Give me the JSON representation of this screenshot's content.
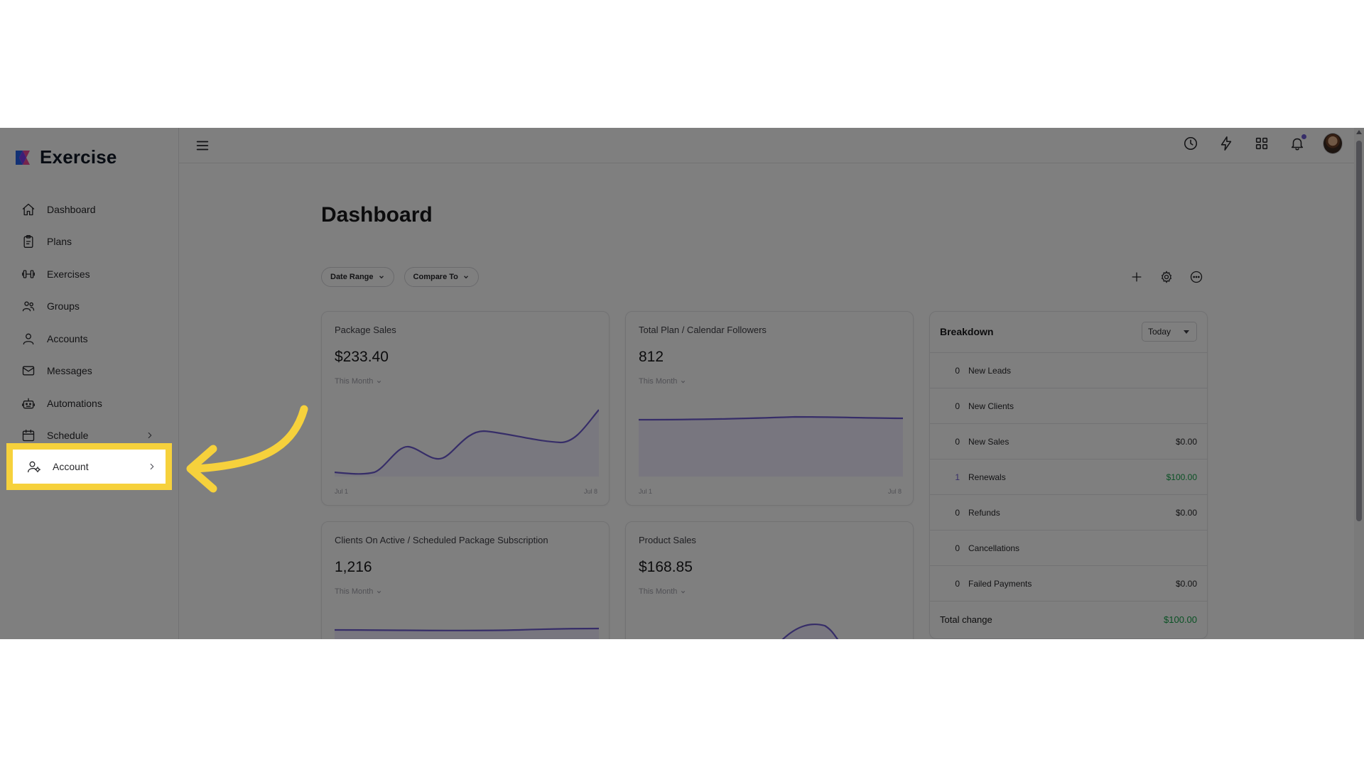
{
  "app": {
    "name": "Exercise"
  },
  "sidebar": {
    "items": [
      {
        "label": "Dashboard",
        "icon": "home-icon"
      },
      {
        "label": "Plans",
        "icon": "clipboard-icon"
      },
      {
        "label": "Exercises",
        "icon": "dumbbell-icon"
      },
      {
        "label": "Groups",
        "icon": "users-icon"
      },
      {
        "label": "Accounts",
        "icon": "user-icon"
      },
      {
        "label": "Messages",
        "icon": "mail-icon"
      },
      {
        "label": "Automations",
        "icon": "robot-icon"
      },
      {
        "label": "Schedule",
        "icon": "calendar-icon"
      },
      {
        "label": "Account",
        "icon": "user-gear-icon"
      }
    ]
  },
  "main": {
    "title": "Dashboard",
    "filters": {
      "date_range": "Date Range",
      "compare_to": "Compare To"
    }
  },
  "cards": {
    "package_sales": {
      "title": "Package Sales",
      "value": "$233.40",
      "period": "This Month",
      "axis_start": "Jul 1",
      "axis_end": "Jul 8"
    },
    "followers": {
      "title": "Total Plan / Calendar Followers",
      "value": "812",
      "period": "This Month",
      "axis_start": "Jul 1",
      "axis_end": "Jul 8"
    },
    "subscriptions": {
      "title": "Clients On Active / Scheduled Package Subscription",
      "value": "1,216",
      "period": "This Month"
    },
    "product_sales": {
      "title": "Product Sales",
      "value": "$168.85",
      "period": "This Month"
    }
  },
  "breakdown": {
    "title": "Breakdown",
    "range": "Today",
    "rows": [
      {
        "count": "0",
        "label": "New Leads",
        "amount": ""
      },
      {
        "count": "0",
        "label": "New Clients",
        "amount": ""
      },
      {
        "count": "0",
        "label": "New Sales",
        "amount": "$0.00"
      },
      {
        "count": "1",
        "label": "Renewals",
        "amount": "$100.00"
      },
      {
        "count": "0",
        "label": "Refunds",
        "amount": "$0.00"
      },
      {
        "count": "0",
        "label": "Cancellations",
        "amount": ""
      },
      {
        "count": "0",
        "label": "Failed Payments",
        "amount": "$0.00"
      }
    ],
    "total_label": "Total change",
    "total_amount": "$100.00"
  },
  "colors": {
    "accent": "#6d5bd0",
    "positive": "#16a34a",
    "highlight": "#f6d13c"
  }
}
